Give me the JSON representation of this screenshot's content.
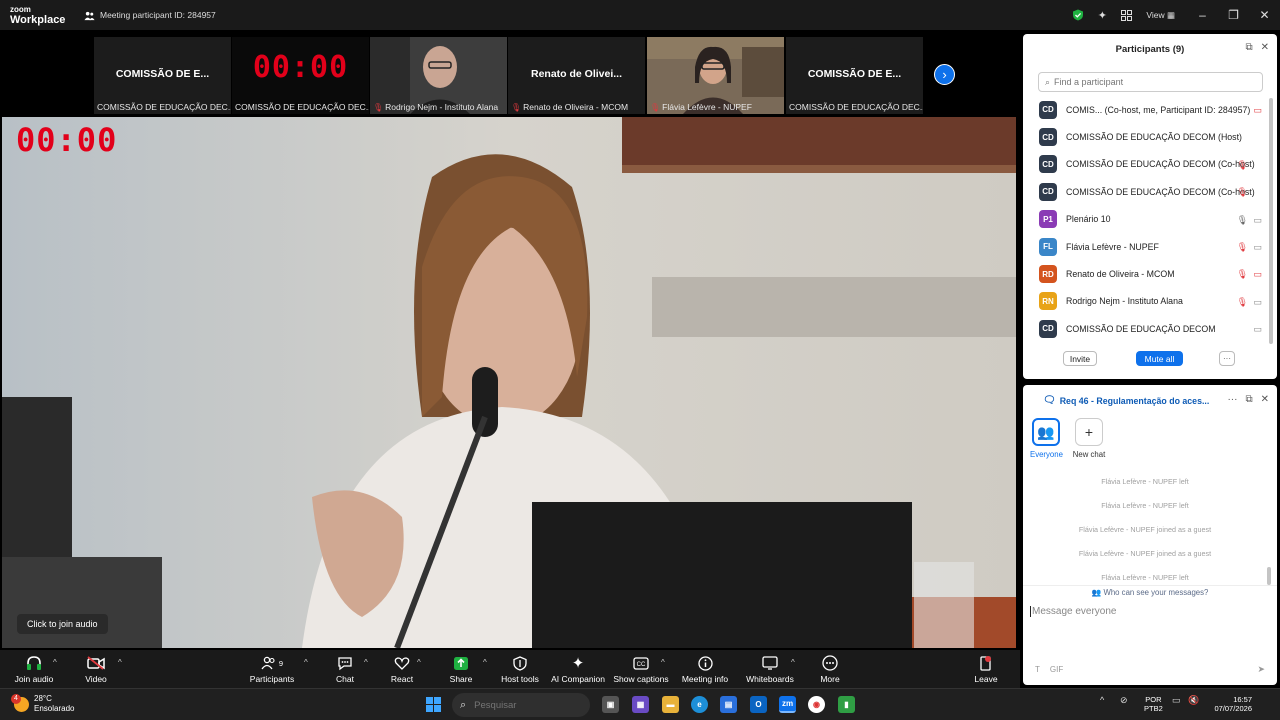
{
  "window": {
    "app_name_line1": "zoom",
    "app_name_line2": "Workplace",
    "meeting_participant_id": "Meeting participant ID: 284957",
    "view_label": "View"
  },
  "thumbnails": [
    {
      "big": "COMISSÃO DE E...",
      "caption": "COMISSÃO DE EDUCAÇÃO DEC...",
      "muted": false
    },
    {
      "timer": "00:00",
      "caption": "COMISSÃO DE EDUCAÇÃO DEC...",
      "muted": false
    },
    {
      "caption": "Rodrigo Nejm - Instituto Alana",
      "muted": true
    },
    {
      "big": "Renato de Olivei...",
      "caption": "Renato de Oliveira - MCOM",
      "muted": true
    },
    {
      "caption": "Flávia Lefèvre - NUPEF",
      "muted": true
    },
    {
      "big": "COMISSÃO DE E...",
      "caption": "COMISSÃO DE EDUCAÇÃO DEC...",
      "muted": false
    }
  ],
  "main_video": {
    "timer": "00:00",
    "tooltip": "Click to join audio"
  },
  "toolbar": {
    "join_audio": "Join audio",
    "video": "Video",
    "participants": "Participants",
    "participants_count": "9",
    "chat": "Chat",
    "react": "React",
    "share": "Share",
    "host_tools": "Host tools",
    "ai_companion": "AI Companion",
    "show_captions": "Show captions",
    "meeting_info": "Meeting info",
    "whiteboards": "Whiteboards",
    "more": "More",
    "leave": "Leave"
  },
  "participants_panel": {
    "title": "Participants (9)",
    "search_placeholder": "Find a participant",
    "items": [
      {
        "initials": "CD",
        "color": "#2f3b4c",
        "name": "COMIS...  (Co-host, me, Participant ID: 284957)",
        "mic": "",
        "video": "off"
      },
      {
        "initials": "CD",
        "color": "#2f3b4c",
        "name": "COMISSÃO DE EDUCAÇÃO DECOM (Host)",
        "mic": "",
        "video": ""
      },
      {
        "initials": "CD",
        "color": "#2f3b4c",
        "name": "COMISSÃO DE EDUCAÇÃO DECOM (Co-host)",
        "mic": "muted",
        "video": ""
      },
      {
        "initials": "CD",
        "color": "#2f3b4c",
        "name": "COMISSÃO DE EDUCAÇÃO DECOM (Co-host)",
        "mic": "muted",
        "video": ""
      },
      {
        "initials": "P1",
        "color": "#8a3bb5",
        "name": "Plenário 10",
        "mic": "on",
        "video": "on"
      },
      {
        "initials": "FL",
        "color": "#3a86c8",
        "name": "Flávia Lefèvre - NUPEF",
        "mic": "muted",
        "video": "on"
      },
      {
        "initials": "RD",
        "color": "#d4541e",
        "name": "Renato de Oliveira - MCOM",
        "mic": "muted",
        "video": "off"
      },
      {
        "initials": "RN",
        "color": "#e8a317",
        "name": "Rodrigo Nejm - Instituto Alana",
        "mic": "muted",
        "video": "on"
      },
      {
        "initials": "CD",
        "color": "#2f3b4c",
        "name": "COMISSÃO DE EDUCAÇÃO DECOM",
        "mic": "",
        "video": "on"
      }
    ],
    "invite": "Invite",
    "mute_all": "Mute all",
    "more": "···"
  },
  "chat_panel": {
    "title": "Req 46 -  Regulamentação do aces...",
    "channels": {
      "everyone": "Everyone",
      "new_chat": "New chat"
    },
    "messages": [
      "Flávia Lefèvre - NUPEF left",
      "Flávia Lefèvre - NUPEF left",
      "Flávia Lefèvre - NUPEF joined as a guest",
      "Flávia Lefèvre - NUPEF joined as a guest",
      "Flávia Lefèvre - NUPEF left"
    ],
    "who_can_see": "Who can see your messages?",
    "input_placeholder": "Message everyone",
    "gif_label": "GIF"
  },
  "taskbar": {
    "temperature": "28°C",
    "weather": "Ensolarado",
    "weather_badge": "4",
    "search_placeholder": "Pesquisar",
    "lang_line1": "POR",
    "lang_line2": "PTB2",
    "time": "16:57",
    "date": "07/07/2026"
  }
}
